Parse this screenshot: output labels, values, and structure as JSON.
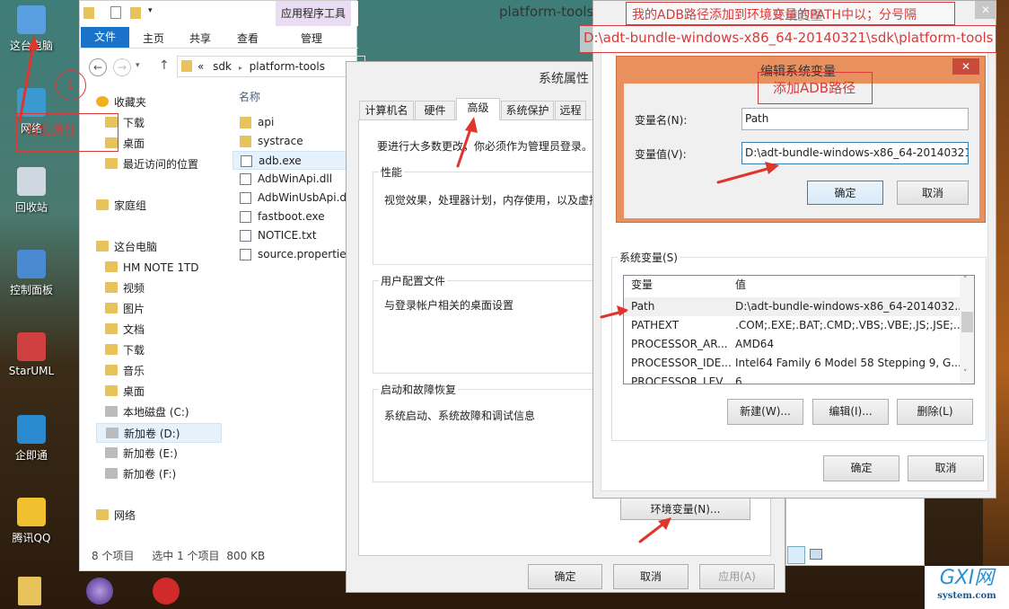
{
  "desktop": {
    "icons": [
      {
        "label": "这台电脑"
      },
      {
        "label": "网络"
      },
      {
        "label": "回收站"
      },
      {
        "label": "控制面板"
      },
      {
        "label": "StarUML"
      },
      {
        "label": "企即通"
      },
      {
        "label": "腾讯QQ"
      }
    ]
  },
  "explorer": {
    "title": "platform-tools",
    "context_tab_group": "应用程序工具",
    "ribbon_tabs": [
      "文件",
      "主页",
      "共享",
      "查看",
      "管理"
    ],
    "breadcrumb": {
      "overflow": "«",
      "parts": [
        "sdk",
        "platform-tools"
      ]
    },
    "nav": [
      {
        "label": "收藏夹",
        "icon": "star-icon"
      },
      {
        "label": "下载",
        "icon": "downloads-icon"
      },
      {
        "label": "桌面",
        "icon": "desktop-icon"
      },
      {
        "label": "最近访问的位置",
        "icon": "recent-icon"
      },
      {
        "label": "家庭组",
        "icon": "homegroup-icon"
      },
      {
        "label": "这台电脑",
        "icon": "computer-icon"
      },
      {
        "label": "HM NOTE 1TD",
        "icon": "phone-icon"
      },
      {
        "label": "视频",
        "icon": "folder-icon"
      },
      {
        "label": "图片",
        "icon": "folder-icon"
      },
      {
        "label": "文档",
        "icon": "folder-icon"
      },
      {
        "label": "下载",
        "icon": "folder-icon"
      },
      {
        "label": "音乐",
        "icon": "folder-icon"
      },
      {
        "label": "桌面",
        "icon": "folder-icon"
      },
      {
        "label": "本地磁盘 (C:)",
        "icon": "drive-icon"
      },
      {
        "label": "新加卷 (D:)",
        "icon": "drive-icon",
        "selected": true
      },
      {
        "label": "新加卷 (E:)",
        "icon": "drive-icon"
      },
      {
        "label": "新加卷 (F:)",
        "icon": "drive-icon"
      },
      {
        "label": "网络",
        "icon": "network-icon"
      }
    ],
    "column_header": "名称",
    "files": [
      {
        "name": "api",
        "icon": "folder-icon"
      },
      {
        "name": "systrace",
        "icon": "folder-icon"
      },
      {
        "name": "adb.exe",
        "icon": "exe-icon",
        "selected": true
      },
      {
        "name": "AdbWinApi.dll",
        "icon": "dll-icon"
      },
      {
        "name": "AdbWinUsbApi.d",
        "icon": "dll-icon"
      },
      {
        "name": "fastboot.exe",
        "icon": "exe-icon"
      },
      {
        "name": "NOTICE.txt",
        "icon": "txt-icon"
      },
      {
        "name": "source.propertie",
        "icon": "file-icon"
      }
    ],
    "status": {
      "count": "8 个项目",
      "selection": "选中 1 个项目",
      "size": "800 KB"
    }
  },
  "system_properties": {
    "title": "系统属性",
    "tabs": [
      "计算机名",
      "硬件",
      "高级",
      "系统保护",
      "远程"
    ],
    "active_tab": "高级",
    "admin_note": "要进行大多数更改，你必须作为管理员登录。",
    "groups": [
      {
        "title": "性能",
        "desc": "视觉效果，处理器计划，内存使用，以及虚拟内存"
      },
      {
        "title": "用户配置文件",
        "desc": "与登录帐户相关的桌面设置"
      },
      {
        "title": "启动和故障恢复",
        "desc": "系统启动、系统故障和调试信息"
      }
    ],
    "env_button": "环境变量(N)...",
    "ok": "确定",
    "cancel": "取消",
    "apply": "应用(A)"
  },
  "env_vars": {
    "title": "环境变量",
    "system_group": "系统变量(S)",
    "columns": [
      "变量",
      "值"
    ],
    "rows": [
      {
        "name": "Path",
        "value": "D:\\adt-bundle-windows-x86_64-2014032..."
      },
      {
        "name": "PATHEXT",
        "value": ".COM;.EXE;.BAT;.CMD;.VBS;.VBE;.JS;.JSE;...."
      },
      {
        "name": "PROCESSOR_AR...",
        "value": "AMD64"
      },
      {
        "name": "PROCESSOR_IDE...",
        "value": "Intel64 Family 6 Model 58 Stepping 9, G..."
      },
      {
        "name": "PROCESSOR_LEV...",
        "value": "6"
      }
    ],
    "new": "新建(W)...",
    "edit": "编辑(I)...",
    "delete": "删除(L)",
    "ok": "确定",
    "cancel": "取消"
  },
  "edit_var": {
    "title": "编辑系统变量",
    "name_label": "变量名(N):",
    "name_value": "Path",
    "value_label": "变量值(V):",
    "value_value": "D:\\adt-bundle-windows-x86_64-20140321\\",
    "ok": "确定",
    "cancel": "取消",
    "accent": "#e8905e"
  },
  "annotations": {
    "step_number": "1",
    "right_click": "右键属性",
    "add_to_path": "我的ADB路径添加到环境变量的PATH中以；分号隔",
    "path_text": "D:\\adt-bundle-windows-x86_64-20140321\\sdk\\platform-tools",
    "add_adb": "添加ADB路径",
    "color": "#d83a3a"
  },
  "watermark": {
    "main": "GXI网",
    "sub": "system.com"
  }
}
